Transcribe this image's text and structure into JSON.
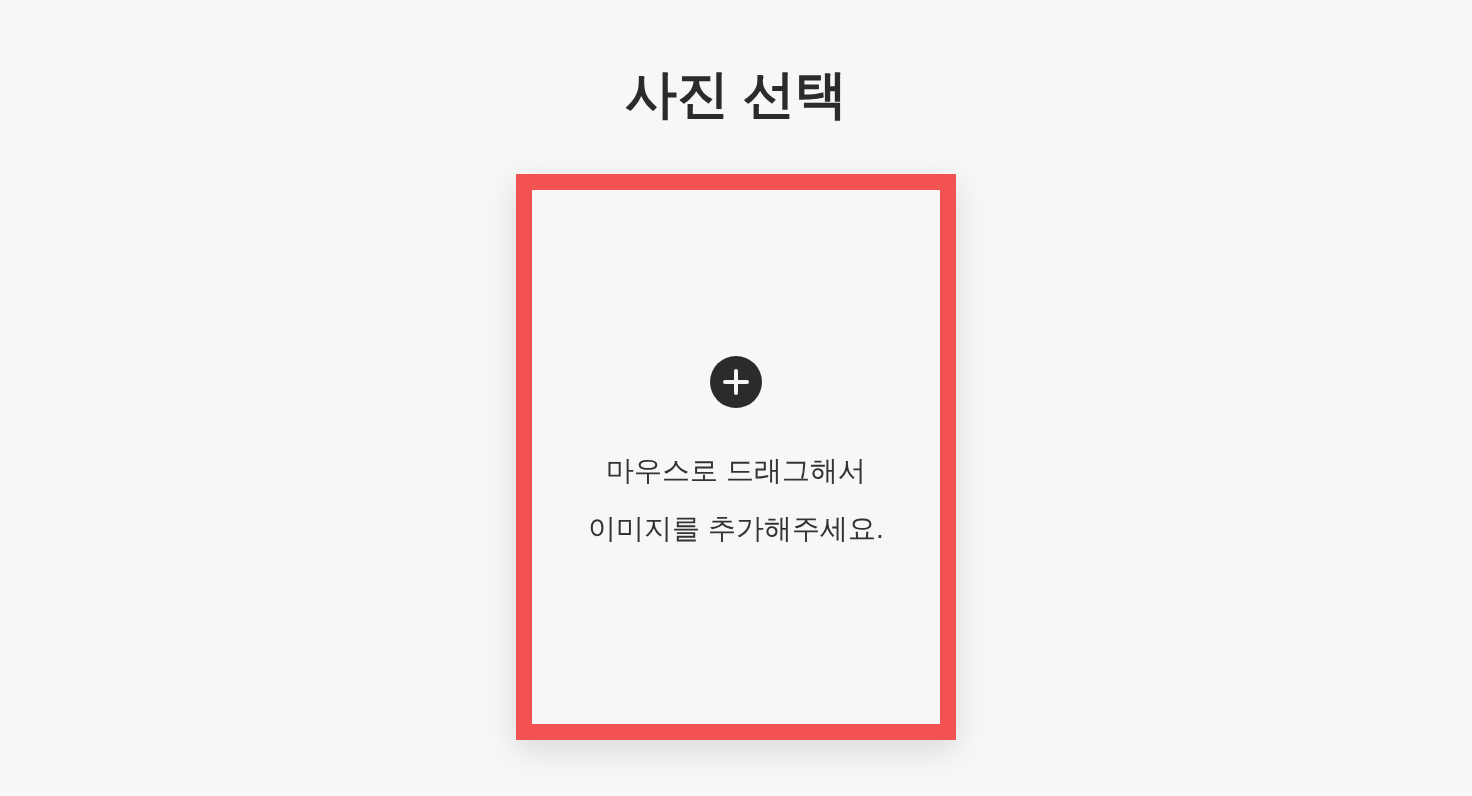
{
  "title": "사진 선택",
  "drop_zone": {
    "message": "마우스로 드래그해서\n이미지를 추가해주세요."
  }
}
